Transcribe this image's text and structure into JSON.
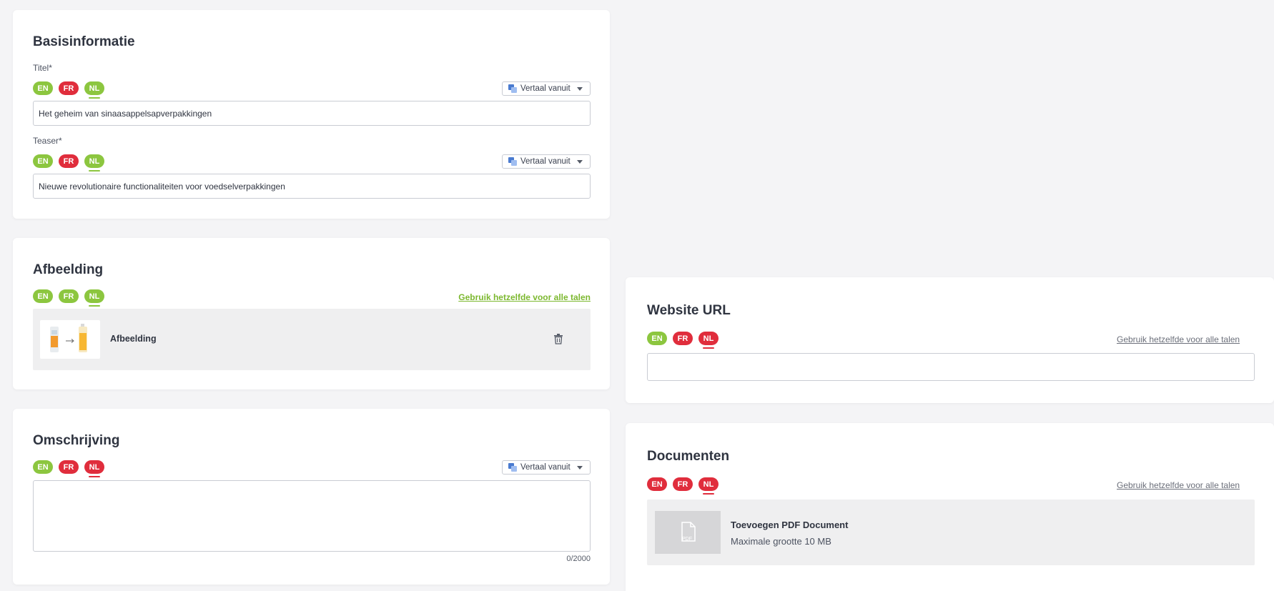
{
  "basis": {
    "title": "Basisinformatie",
    "titel_label": "Titel*",
    "titel_value": "Het geheim van sinaasappelsapverpakkingen",
    "teaser_label": "Teaser*",
    "teaser_value": "Nieuwe revolutionaire functionaliteiten voor voedselverpakkingen",
    "translate_label": "Vertaal vanuit"
  },
  "langs": [
    "EN",
    "FR",
    "NL"
  ],
  "afbeelding": {
    "title": "Afbeelding",
    "same_for_all": "Gebruik hetzelfde voor alle talen",
    "item_label": "Afbeelding"
  },
  "omschrijving": {
    "title": "Omschrijving",
    "translate_label": "Vertaal vanuit",
    "value": "",
    "counter": "0/2000"
  },
  "website": {
    "title": "Website URL",
    "same_for_all": "Gebruik hetzelfde voor alle talen",
    "value": ""
  },
  "documenten": {
    "title": "Documenten",
    "same_for_all": "Gebruik hetzelfde voor alle talen",
    "add_label": "Toevoegen PDF Document",
    "max_size": "Maximale grootte 10 MB",
    "pdf_text": "PDF"
  },
  "colors": {
    "green": "#8cc63f",
    "red": "#e02d3c",
    "link_green": "#7cb82f",
    "link_gray": "#6b6f7a"
  }
}
